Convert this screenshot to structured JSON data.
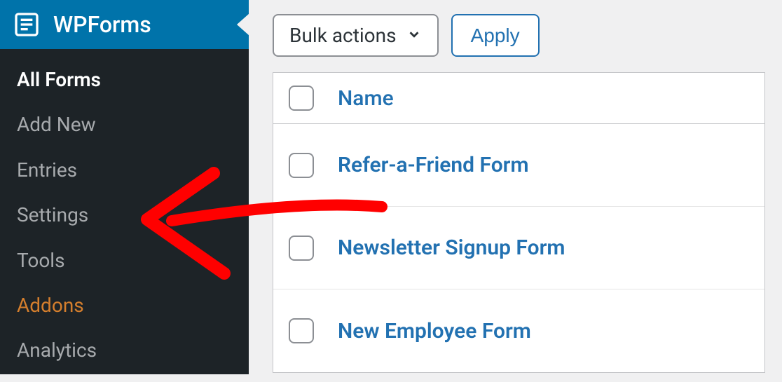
{
  "sidebar": {
    "title": "WPForms",
    "items": [
      {
        "label": "All Forms",
        "state": "active"
      },
      {
        "label": "Add New",
        "state": ""
      },
      {
        "label": "Entries",
        "state": ""
      },
      {
        "label": "Settings",
        "state": ""
      },
      {
        "label": "Tools",
        "state": ""
      },
      {
        "label": "Addons",
        "state": "highlight"
      },
      {
        "label": "Analytics",
        "state": ""
      }
    ]
  },
  "toolbar": {
    "bulk_label": "Bulk actions",
    "apply_label": "Apply"
  },
  "table": {
    "header_name": "Name",
    "rows": [
      {
        "title": "Refer-a-Friend Form"
      },
      {
        "title": "Newsletter Signup Form"
      },
      {
        "title": "New Employee Form"
      }
    ]
  }
}
